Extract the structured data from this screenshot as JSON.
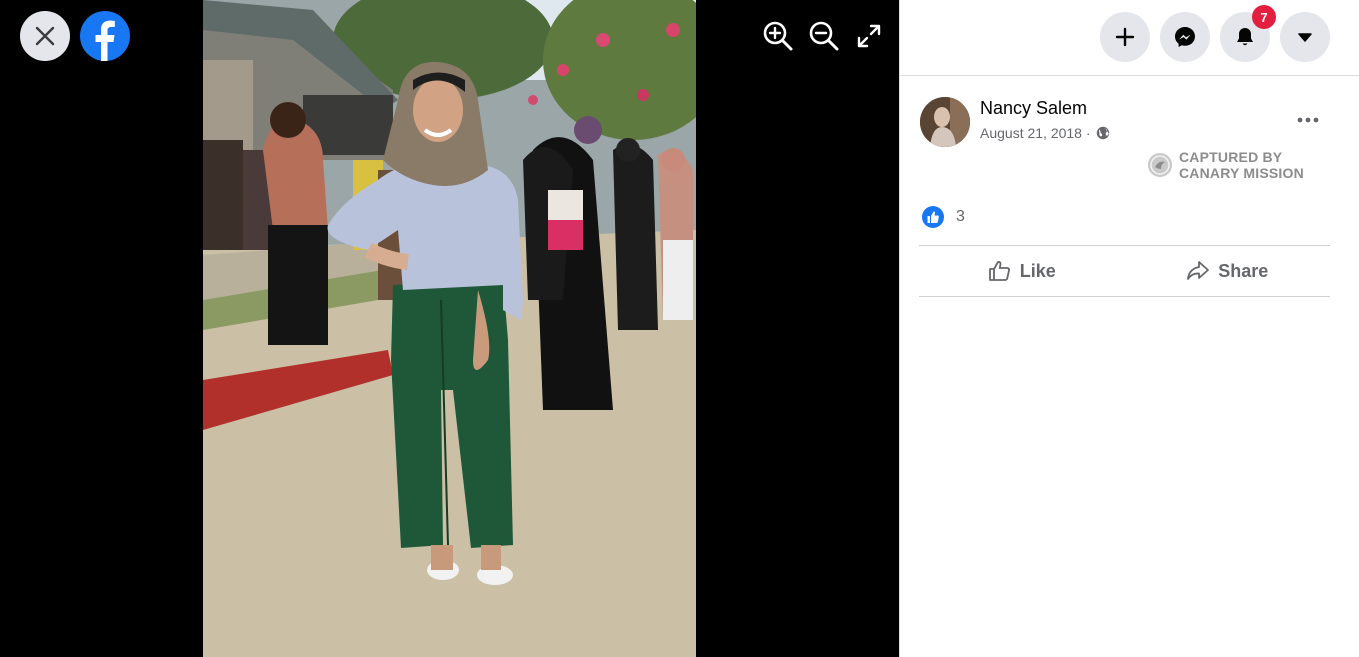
{
  "viewer": {
    "icons": {
      "close": "close-icon",
      "brand": "facebook-logo",
      "zoom_in": "zoom-in-icon",
      "zoom_out": "zoom-out-icon",
      "fullscreen": "fullscreen-icon"
    },
    "photo": "woman-in-hijab-green-trousers-at-outdoor-gathering"
  },
  "topbar": {
    "buttons": [
      "create-icon",
      "messenger-icon",
      "notifications-icon",
      "account-menu-icon"
    ],
    "notification_count": "7"
  },
  "post": {
    "author": "Nancy Salem",
    "date": "August 21, 2018 ·",
    "privacy_icon": "globe-icon",
    "watermark_line1": "CAPTURED BY",
    "watermark_line2": "CANARY MISSION",
    "reaction_count": "3",
    "like_label": "Like",
    "share_label": "Share"
  },
  "colors": {
    "brand": "#1877f2",
    "badge": "#e41e3f",
    "button_bg": "#e4e6eb",
    "secondary_text": "#65676b"
  }
}
